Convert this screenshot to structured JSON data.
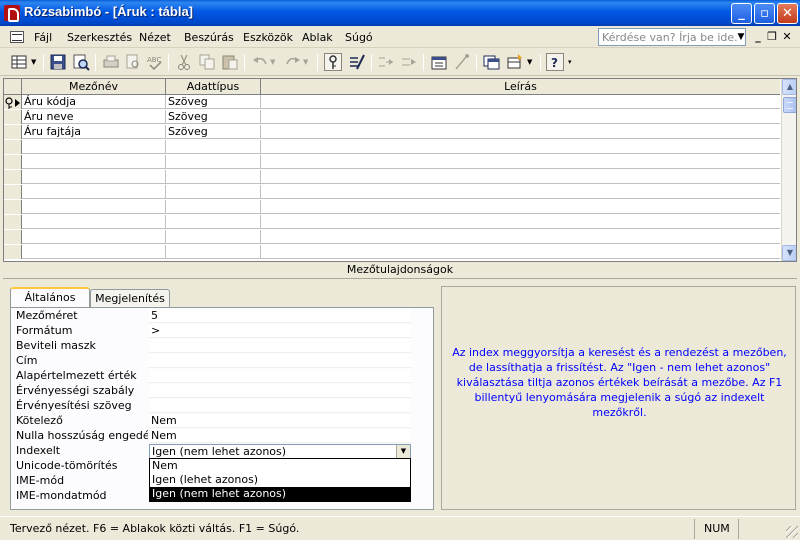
{
  "window": {
    "title": "Rózsabimbó - [Áruk : tábla]",
    "controls": {
      "minimize": "_",
      "maximize": "▫",
      "close": "✕"
    }
  },
  "menubar": {
    "items": [
      "Fájl",
      "Szerkesztés",
      "Nézet",
      "Beszúrás",
      "Eszközök",
      "Ablak",
      "Súgó"
    ],
    "help_placeholder": "Kérdése van? Írja be ide.",
    "mdi_controls": [
      "_",
      "❐",
      "✕"
    ]
  },
  "toolbar": {
    "icons": [
      "view-icon",
      "save-icon",
      "search-icon",
      "print-icon",
      "print-preview-icon",
      "spelling-icon",
      "cut-icon",
      "copy-icon",
      "paste-icon",
      "undo-icon",
      "redo-icon",
      "primary-key-icon",
      "indexes-icon",
      "insert-rows-icon",
      "delete-rows-icon",
      "properties-icon",
      "build-icon",
      "database-window-icon",
      "new-object-icon",
      "help-icon"
    ]
  },
  "grid": {
    "headers": [
      "Mezőnév",
      "Adattípus",
      "Leírás"
    ],
    "rows": [
      {
        "name": "Áru kódja",
        "type": "Szöveg",
        "desc": "",
        "primary_key": true
      },
      {
        "name": "Áru neve",
        "type": "Szöveg",
        "desc": ""
      },
      {
        "name": "Áru fajtája",
        "type": "Szöveg",
        "desc": ""
      }
    ],
    "key_icon": "key-icon"
  },
  "properties": {
    "section_title": "Mezőtulajdonságok",
    "tabs": [
      "Általános",
      "Megjelenítés"
    ],
    "active_tab": "Általános",
    "rows": [
      {
        "label": "Mezőméret",
        "value": "5"
      },
      {
        "label": "Formátum",
        "value": ">"
      },
      {
        "label": "Beviteli maszk",
        "value": ""
      },
      {
        "label": "Cím",
        "value": ""
      },
      {
        "label": "Alapértelmezett érték",
        "value": ""
      },
      {
        "label": "Érvényességi szabály",
        "value": ""
      },
      {
        "label": "Érvényesítési szöveg",
        "value": ""
      },
      {
        "label": "Kötelező",
        "value": "Nem"
      },
      {
        "label": "Nulla hosszúság engedélyezett",
        "value": "Nem"
      },
      {
        "label": "Indexelt",
        "value": "Igen (nem lehet azonos)"
      },
      {
        "label": "Unicode-tömörítés",
        "value": ""
      },
      {
        "label": "IME-mód",
        "value": ""
      },
      {
        "label": "IME-mondatmód",
        "value": ""
      }
    ],
    "indexed_options": [
      "Nem",
      "Igen (lehet azonos)",
      "Igen (nem lehet azonos)"
    ],
    "indexed_selected": "Igen (nem lehet azonos)",
    "description": "Az index meggyorsítja a keresést és a rendezést a mezőben, de lassíthatja a frissítést. Az \"Igen - nem lehet azonos\" kiválasztása tiltja azonos értékek beírását a mezőbe. Az F1 billentyű lenyomására megjelenik a súgó az indexelt mezőkről."
  },
  "statusbar": {
    "text": "Tervező nézet. F6 = Ablakok közti váltás. F1 = Súgó.",
    "num": "NUM"
  },
  "colors": {
    "titlebar": "#0058E6",
    "description_text": "#0000FF",
    "tab_highlight": "#FFC83C",
    "face": "#ECE9D8"
  }
}
